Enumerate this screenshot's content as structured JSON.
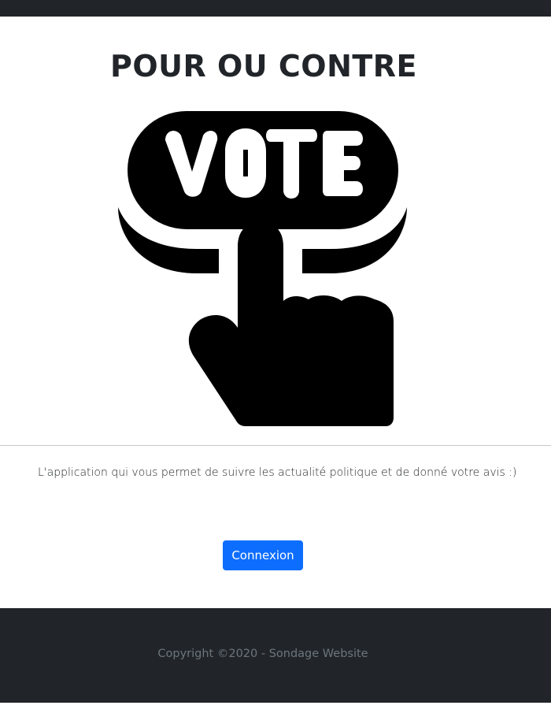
{
  "header": {
    "title": "POUR OU CONTRE"
  },
  "logo": {
    "text": "VOTE",
    "icon": "vote-hand-icon"
  },
  "main": {
    "intro_text": "L'application qui vous permet de suivre les actualité politique et de donné votre avis :)",
    "login_button_label": "Connexion"
  },
  "footer": {
    "copyright": "Copyright ©2020 - Sondage Website"
  },
  "colors": {
    "dark": "#212529",
    "primary": "#0d6efd",
    "muted": "#6c757d",
    "background": "#ffffff"
  }
}
